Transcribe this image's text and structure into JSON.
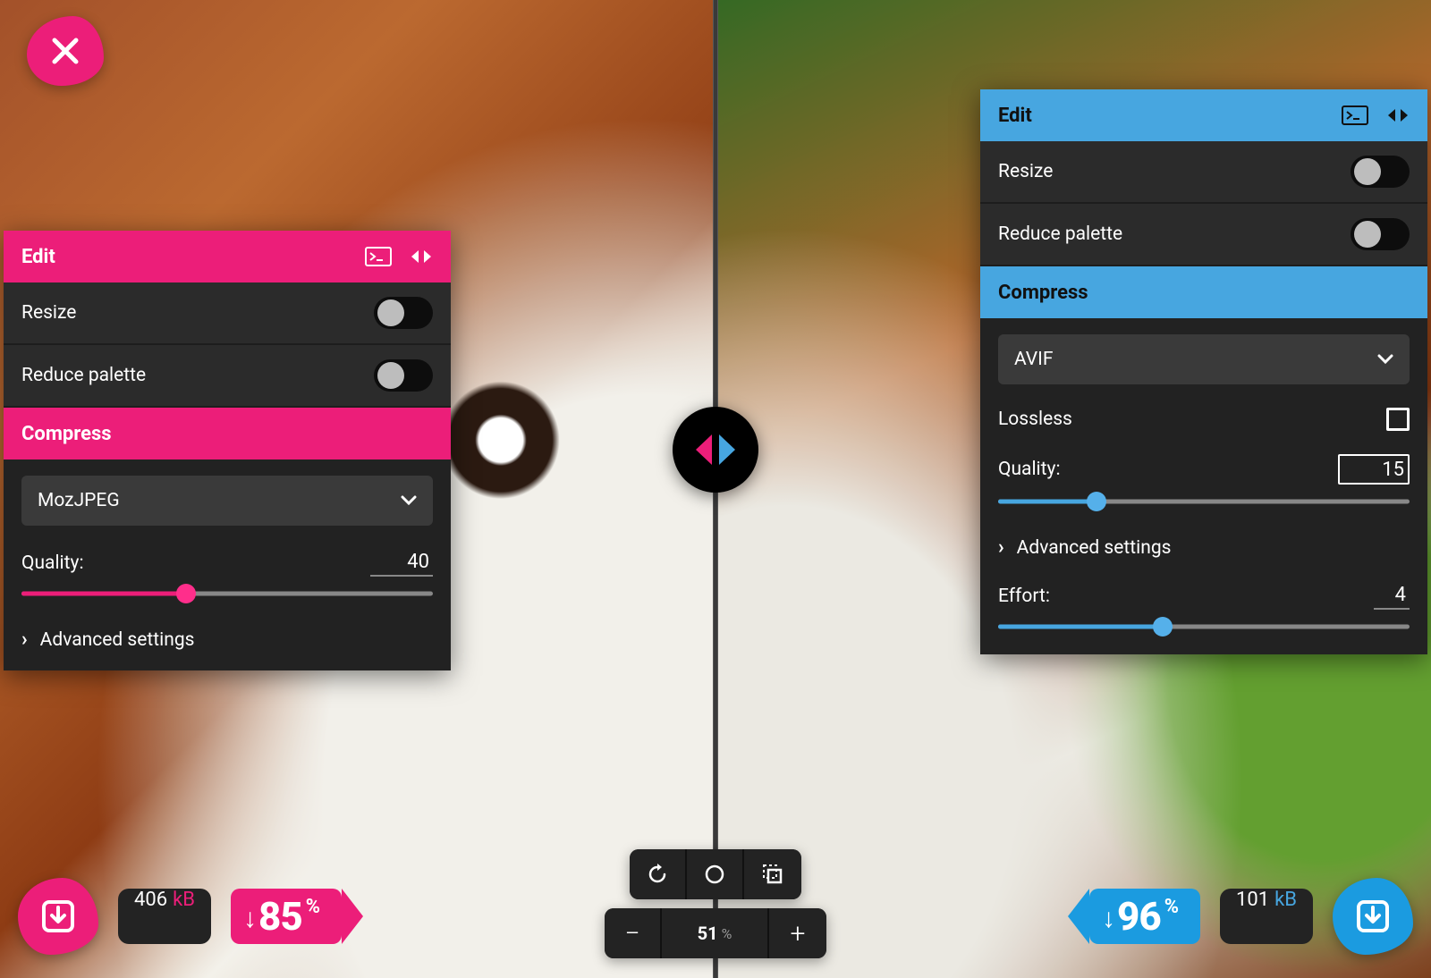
{
  "colors": {
    "pink": "#ec1e79",
    "blue": "#47a6e0"
  },
  "left": {
    "edit_title": "Edit",
    "resize_label": "Resize",
    "palette_label": "Reduce palette",
    "compress_title": "Compress",
    "codec_selected": "MozJPEG",
    "quality_label": "Quality:",
    "quality_value": "40",
    "quality_pct": 40,
    "advanced_label": "Advanced settings",
    "filesize_value": "406",
    "filesize_unit": "kB",
    "reduction_pct": "85",
    "pct_symbol": "%"
  },
  "right": {
    "edit_title": "Edit",
    "resize_label": "Resize",
    "palette_label": "Reduce palette",
    "compress_title": "Compress",
    "codec_selected": "AVIF",
    "lossless_label": "Lossless",
    "quality_label": "Quality:",
    "quality_value": "15",
    "quality_pct": 24,
    "advanced_label": "Advanced settings",
    "effort_label": "Effort:",
    "effort_value": "4",
    "effort_pct": 40,
    "filesize_value": "101",
    "filesize_unit": "kB",
    "reduction_pct": "96",
    "pct_symbol": "%"
  },
  "zoom": {
    "value": "51",
    "pct_symbol": "%"
  }
}
